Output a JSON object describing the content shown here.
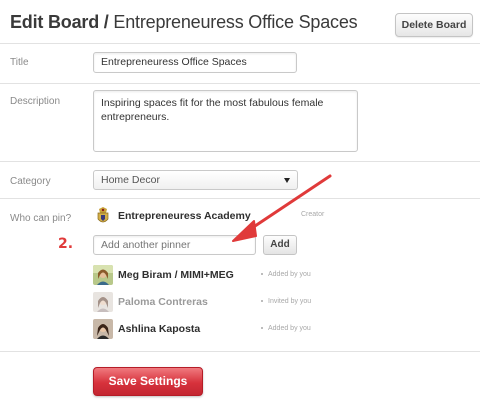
{
  "header": {
    "title_prefix": "Edit Board /",
    "board_name": "Entrepreneuress Office Spaces",
    "delete_label": "Delete Board"
  },
  "form": {
    "title_label": "Title",
    "title_value": "Entrepreneuress Office Spaces",
    "description_label": "Description",
    "description_value": "Inspiring spaces fit for the most fabulous female entrepreneurs.",
    "category_label": "Category",
    "category_value": "Home Decor",
    "who_can_pin_label": "Who can pin?"
  },
  "pinners": {
    "owner": {
      "name": "Entrepreneuress Academy",
      "role": "Creator",
      "icon": "academy-crest-icon"
    },
    "add_placeholder": "Add another pinner",
    "add_label": "Add",
    "list": [
      {
        "name": "Meg Biram / MIMI+MEG",
        "status": "Added by you",
        "muted": false
      },
      {
        "name": "Paloma Contreras",
        "status": "Invited by you",
        "muted": true
      },
      {
        "name": "Ashlina Kaposta",
        "status": "Added by you",
        "muted": false
      }
    ]
  },
  "annotation": {
    "step": "2.",
    "arrow_color": "#e03a3a"
  },
  "save_label": "Save Settings",
  "colors": {
    "save_button": "#d7323c",
    "annotation": "#e03a3a"
  }
}
